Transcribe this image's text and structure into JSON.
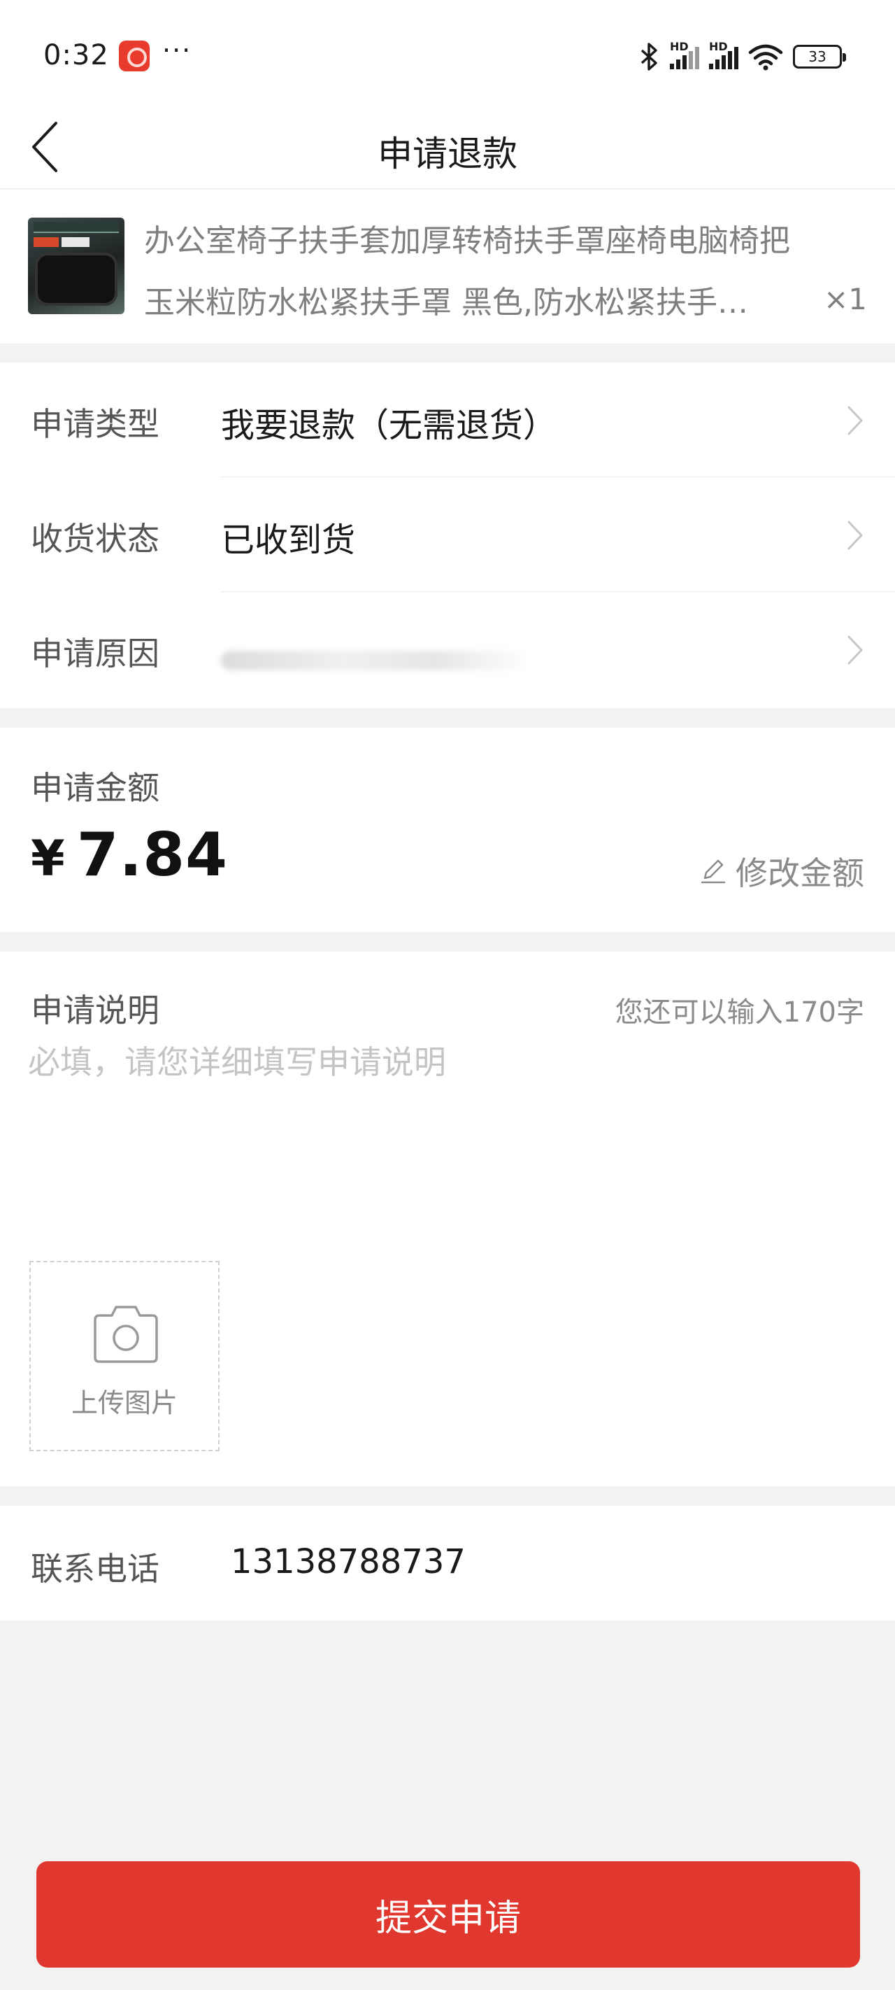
{
  "status_bar": {
    "time": "0:32",
    "dots": "···",
    "network_1": "HD",
    "network_2": "HD",
    "battery": "33"
  },
  "header": {
    "title": "申请退款",
    "back_icon": "chevron-left-icon"
  },
  "product": {
    "title_line1": "办公室椅子扶手套加厚转椅扶手罩座椅电脑椅把",
    "title_line2": "玉米粒防水松紧扶手罩 黑色,防水松紧扶手…",
    "quantity": "×1"
  },
  "form": {
    "rows": [
      {
        "label": "申请类型",
        "value": "我要退款（无需退货）"
      },
      {
        "label": "收货状态",
        "value": "已收到货"
      },
      {
        "label": "申请原因",
        "value": ""
      }
    ]
  },
  "amount": {
    "label": "申请金额",
    "currency": "¥",
    "value": "7.84",
    "edit_label": "修改金额"
  },
  "description": {
    "label": "申请说明",
    "counter": "您还可以输入170字",
    "placeholder": "必填，请您详细填写申请说明",
    "upload_label": "上传图片"
  },
  "contact": {
    "label": "联系电话",
    "phone": "13138788737"
  },
  "submit_label": "提交申请",
  "colors": {
    "accent": "#e0372e",
    "background": "#f2f2f2"
  }
}
